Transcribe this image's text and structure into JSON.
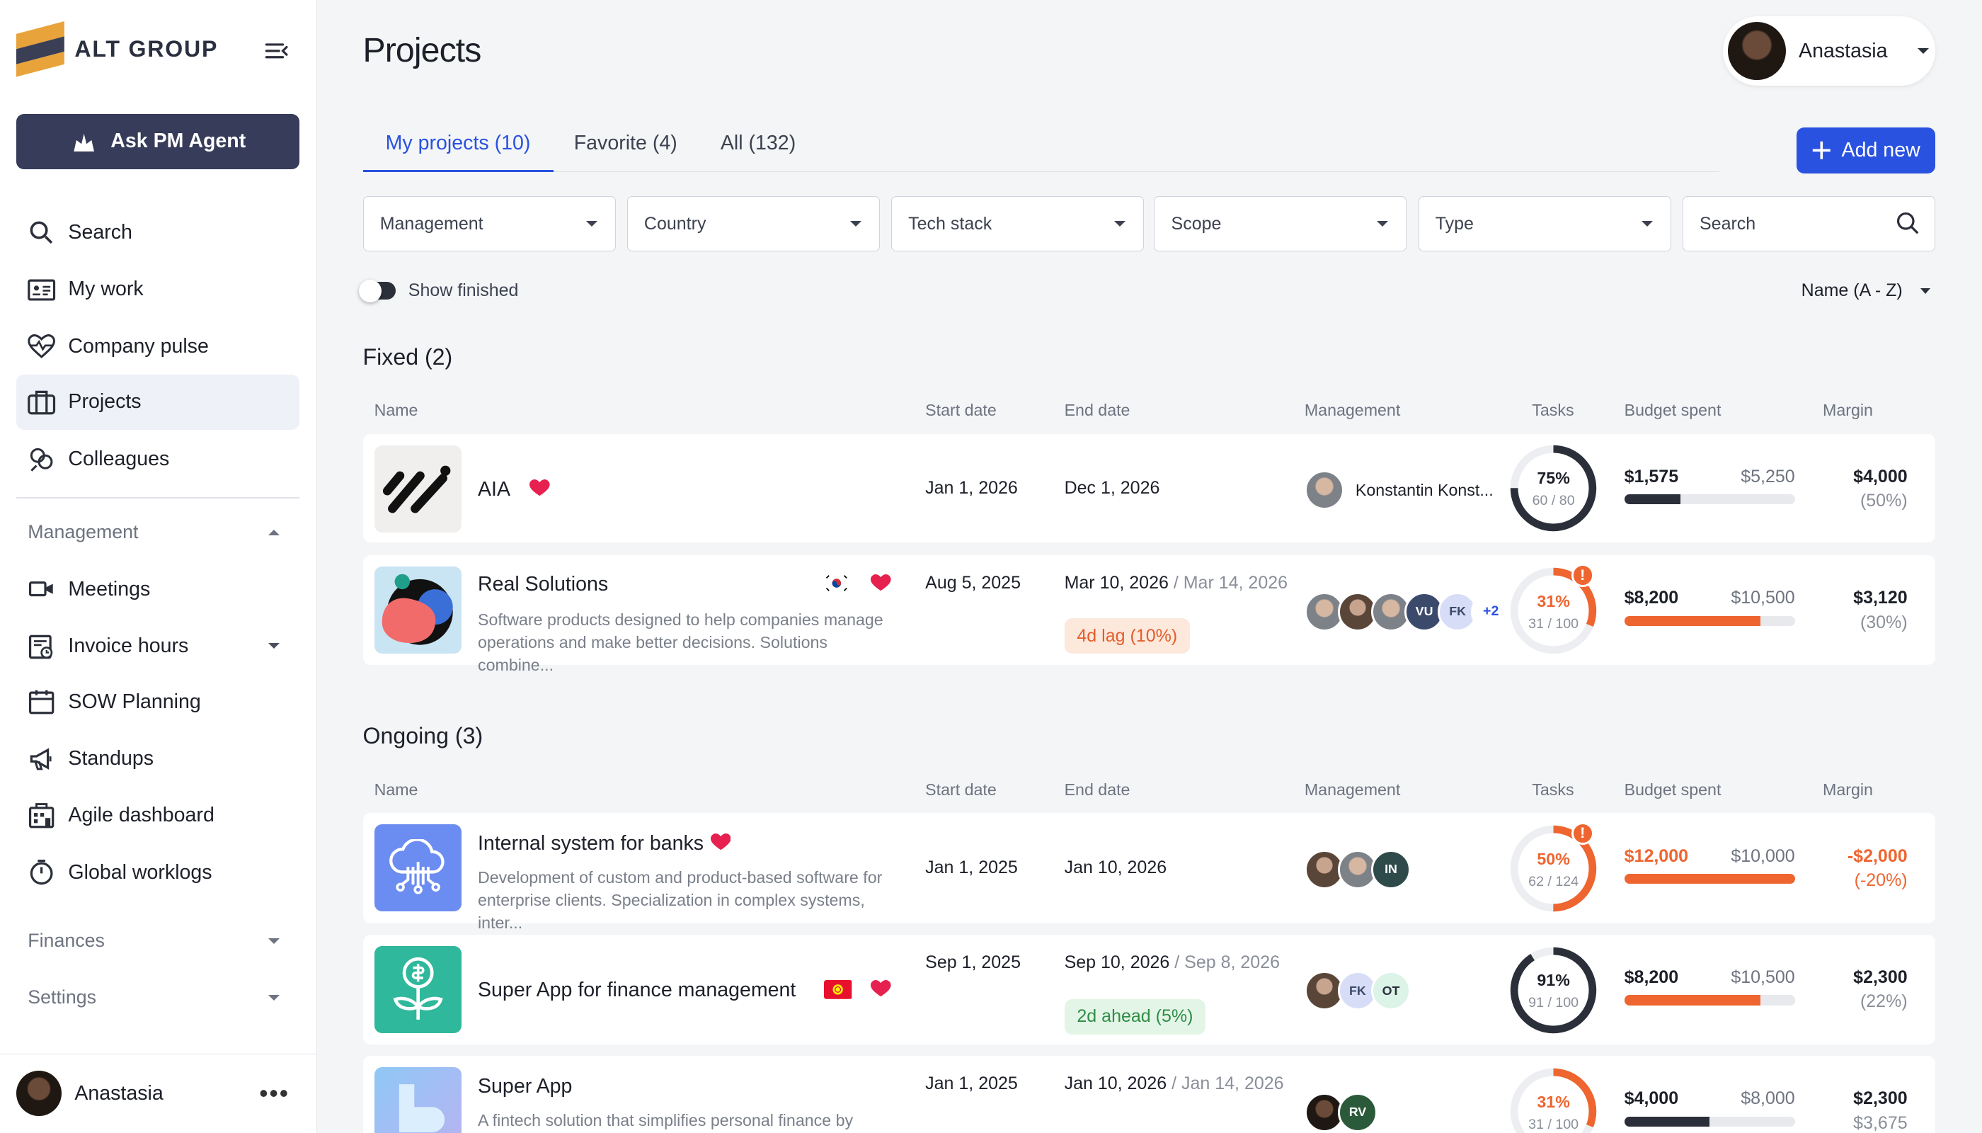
{
  "app": {
    "brand": "ALT GROUP",
    "ask_label": "Ask PM Agent",
    "page_title": "Projects"
  },
  "sidebar": {
    "items": [
      {
        "label": "Search",
        "icon": "search-icon"
      },
      {
        "label": "My work",
        "icon": "id-card-icon"
      },
      {
        "label": "Company pulse",
        "icon": "heartbeat-icon"
      },
      {
        "label": "Projects",
        "icon": "briefcase-icon",
        "active": true
      },
      {
        "label": "Colleagues",
        "icon": "colleagues-icon"
      }
    ],
    "management_label": "Management",
    "management_items": [
      {
        "label": "Meetings",
        "icon": "video-icon"
      },
      {
        "label": "Invoice hours",
        "icon": "invoice-icon"
      },
      {
        "label": "SOW Planning",
        "icon": "calendar-icon"
      },
      {
        "label": "Standups",
        "icon": "megaphone-icon"
      },
      {
        "label": "Agile dashboard",
        "icon": "dashboard-icon"
      },
      {
        "label": "Global worklogs",
        "icon": "stopwatch-icon"
      }
    ],
    "finances_label": "Finances",
    "settings_label": "Settings",
    "user_name": "Anastasia"
  },
  "header": {
    "user_name": "Anastasia"
  },
  "tabs": [
    "My projects (10)",
    "Favorite (4)",
    "All (132)"
  ],
  "add_new_label": "Add new",
  "filters": [
    "Management",
    "Country",
    "Tech stack",
    "Scope",
    "Type"
  ],
  "search_placeholder": "Search",
  "show_finished_label": "Show finished",
  "sort_label": "Name (A - Z)",
  "columns": [
    "Name",
    "Start date",
    "End date",
    "Management",
    "Tasks",
    "Budget spent",
    "Margin"
  ],
  "colors": {
    "accent": "#2952e0",
    "danger": "#ee6530",
    "dark": "#2b2f3a"
  },
  "groups": [
    {
      "title": "Fixed (2)",
      "projects": [
        {
          "name": "AIA",
          "start": "Jan 1, 2026",
          "end": "Dec 1, 2026",
          "manager": "Konstantin Konst...",
          "tasks_pct": "75%",
          "tasks_frac": "60 / 80",
          "tasks_value": 0.75,
          "budget_spent": "$1,575",
          "budget_total": "$5,250",
          "budget_ratio": 0.33,
          "margin": "$4,000",
          "margin_pct": "(50%)"
        },
        {
          "name": "Real Solutions",
          "desc": "Software products designed to help companies manage operations and make better decisions. Solutions combine...",
          "start": "Aug 5, 2025",
          "end": "Mar 10, 2026",
          "end_alt": "/ Mar 14, 2026",
          "badge": "4d lag (10%)",
          "team": [
            "VU",
            "FK"
          ],
          "team_more": "+2",
          "tasks_pct": "31%",
          "tasks_frac": "31 / 100",
          "tasks_value": 0.31,
          "alert": "!",
          "budget_spent": "$8,200",
          "budget_total": "$10,500",
          "budget_ratio": 0.8,
          "margin": "$3,120",
          "margin_pct": "(30%)"
        }
      ]
    },
    {
      "title": "Ongoing (3)",
      "projects": [
        {
          "name": "Internal system for banks",
          "desc": "Development of custom and product-based software for enterprise clients. Specialization in complex systems, inter...",
          "start": "Jan 1, 2025",
          "end": "Jan 10, 2026",
          "team": [
            "IN"
          ],
          "tasks_pct": "50%",
          "tasks_frac": "62 / 124",
          "tasks_value": 0.5,
          "alert": "!",
          "budget_spent": "$12,000",
          "budget_total": "$10,000",
          "budget_ratio": 1.0,
          "margin": "-$2,000",
          "margin_pct": "(-20%)"
        },
        {
          "name": "Super App for finance management",
          "start": "Sep 1, 2025",
          "end": "Sep 10, 2026",
          "end_alt": "/ Sep 8, 2026",
          "badge": "2d ahead (5%)",
          "team": [
            "FK",
            "OT"
          ],
          "tasks_pct": "91%",
          "tasks_frac": "91 / 100",
          "tasks_value": 0.91,
          "budget_spent": "$8,200",
          "budget_total": "$10,500",
          "budget_ratio": 0.8,
          "margin": "$2,300",
          "margin_pct": "(22%)"
        },
        {
          "name": "Super App",
          "desc": "A fintech solution that simplifies personal finance by",
          "start": "Jan 1, 2025",
          "end": "Jan 10, 2026",
          "end_alt": "/ Jan 14, 2026",
          "team": [
            "RV"
          ],
          "tasks_pct": "31%",
          "tasks_frac": "31 / 100",
          "tasks_value": 0.31,
          "budget_spent": "$4,000",
          "budget_total": "$8,000",
          "budget_ratio": 0.5,
          "margin": "$2,300",
          "margin_pct": "$3,675"
        }
      ]
    }
  ]
}
